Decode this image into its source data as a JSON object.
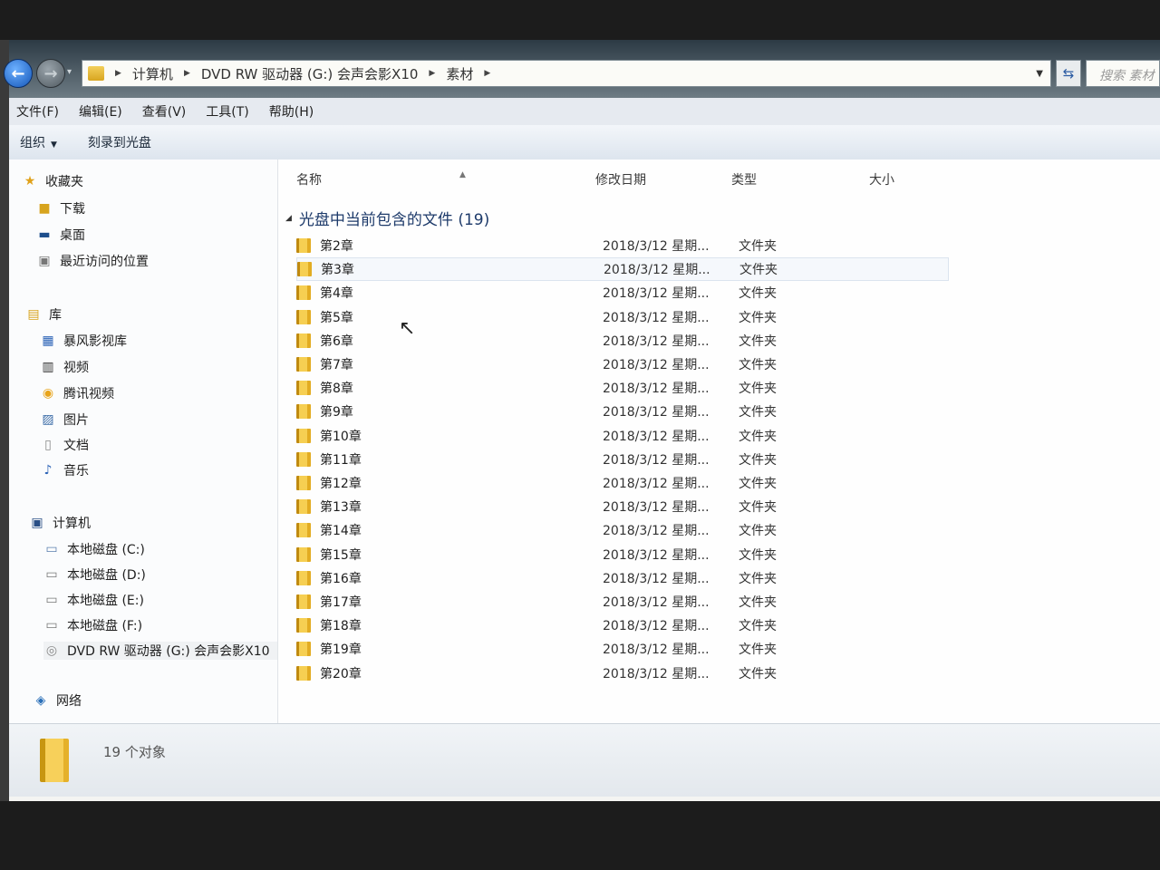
{
  "address": {
    "breadcrumbs": [
      "计算机",
      "DVD RW 驱动器 (G:) 会声会影X10",
      "素材"
    ],
    "search_placeholder": "搜索 素材"
  },
  "menu": [
    "文件(F)",
    "编辑(E)",
    "查看(V)",
    "工具(T)",
    "帮助(H)"
  ],
  "toolbar": {
    "organize": "组织",
    "burn": "刻录到光盘"
  },
  "sidebar": {
    "favorites": {
      "label": "收藏夹",
      "items": [
        "下载",
        "桌面",
        "最近访问的位置"
      ]
    },
    "libraries": {
      "label": "库",
      "items": [
        "暴风影视库",
        "视频",
        "腾讯视频",
        "图片",
        "文档",
        "音乐"
      ]
    },
    "computer": {
      "label": "计算机",
      "items": [
        "本地磁盘 (C:)",
        "本地磁盘 (D:)",
        "本地磁盘 (E:)",
        "本地磁盘 (F:)",
        "DVD RW 驱动器 (G:) 会声会影X10"
      ]
    },
    "network": {
      "label": "网络"
    }
  },
  "columns": {
    "name": "名称",
    "date": "修改日期",
    "type": "类型",
    "size": "大小"
  },
  "group": {
    "title": "光盘中当前包含的文件 (19)"
  },
  "files": [
    {
      "name": "第2章",
      "date": "2018/3/12 星期...",
      "type": "文件夹"
    },
    {
      "name": "第3章",
      "date": "2018/3/12 星期...",
      "type": "文件夹"
    },
    {
      "name": "第4章",
      "date": "2018/3/12 星期...",
      "type": "文件夹"
    },
    {
      "name": "第5章",
      "date": "2018/3/12 星期...",
      "type": "文件夹"
    },
    {
      "name": "第6章",
      "date": "2018/3/12 星期...",
      "type": "文件夹"
    },
    {
      "name": "第7章",
      "date": "2018/3/12 星期...",
      "type": "文件夹"
    },
    {
      "name": "第8章",
      "date": "2018/3/12 星期...",
      "type": "文件夹"
    },
    {
      "name": "第9章",
      "date": "2018/3/12 星期...",
      "type": "文件夹"
    },
    {
      "name": "第10章",
      "date": "2018/3/12 星期...",
      "type": "文件夹"
    },
    {
      "name": "第11章",
      "date": "2018/3/12 星期...",
      "type": "文件夹"
    },
    {
      "name": "第12章",
      "date": "2018/3/12 星期...",
      "type": "文件夹"
    },
    {
      "name": "第13章",
      "date": "2018/3/12 星期...",
      "type": "文件夹"
    },
    {
      "name": "第14章",
      "date": "2018/3/12 星期...",
      "type": "文件夹"
    },
    {
      "name": "第15章",
      "date": "2018/3/12 星期...",
      "type": "文件夹"
    },
    {
      "name": "第16章",
      "date": "2018/3/12 星期...",
      "type": "文件夹"
    },
    {
      "name": "第17章",
      "date": "2018/3/12 星期...",
      "type": "文件夹"
    },
    {
      "name": "第18章",
      "date": "2018/3/12 星期...",
      "type": "文件夹"
    },
    {
      "name": "第19章",
      "date": "2018/3/12 星期...",
      "type": "文件夹"
    },
    {
      "name": "第20章",
      "date": "2018/3/12 星期...",
      "type": "文件夹"
    }
  ],
  "status": {
    "count_text": "19 个对象"
  }
}
